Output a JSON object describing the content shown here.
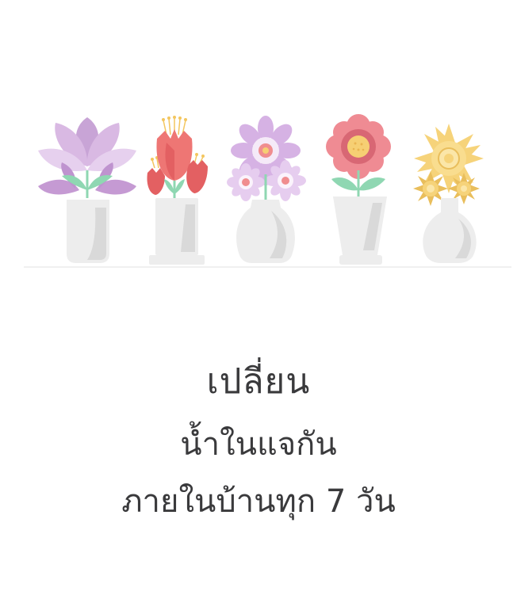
{
  "message": {
    "line1": "เปลี่ยน",
    "line2": "น้ำในแจกัน",
    "line3": "ภายในบ้านทุก 7 วัน"
  },
  "illustration": {
    "vases": [
      {
        "icon": "lotus-flower-icon",
        "colors": {
          "petal": "#d9b9e3",
          "petal_dark": "#c59ad3",
          "leaf": "#8fd7b2"
        }
      },
      {
        "icon": "tulip-flowers-icon",
        "colors": {
          "petal": "#ee7674",
          "petal_dark": "#e36062",
          "stamen": "#f3c65f",
          "leaf": "#8fd7b2"
        }
      },
      {
        "icon": "daisy-flowers-icon",
        "colors": {
          "petal": "#d6b2e4",
          "petal_light": "#f5eaf8",
          "center": "#f08d8f",
          "leaf": "#8fd7b2"
        }
      },
      {
        "icon": "pink-flower-icon",
        "colors": {
          "petal": "#ef8b93",
          "center": "#f6cf73",
          "ring": "#d86774",
          "leaf": "#8fd7b2"
        }
      },
      {
        "icon": "yellow-sunflower-icon",
        "colors": {
          "petal": "#f6d37a",
          "petal_dark": "#e9be5c",
          "center": "#fbe6a8",
          "leaf": "#8fd7b2"
        }
      }
    ],
    "vase_color": "#ededed",
    "vase_shadow": "#d9d9d9"
  }
}
